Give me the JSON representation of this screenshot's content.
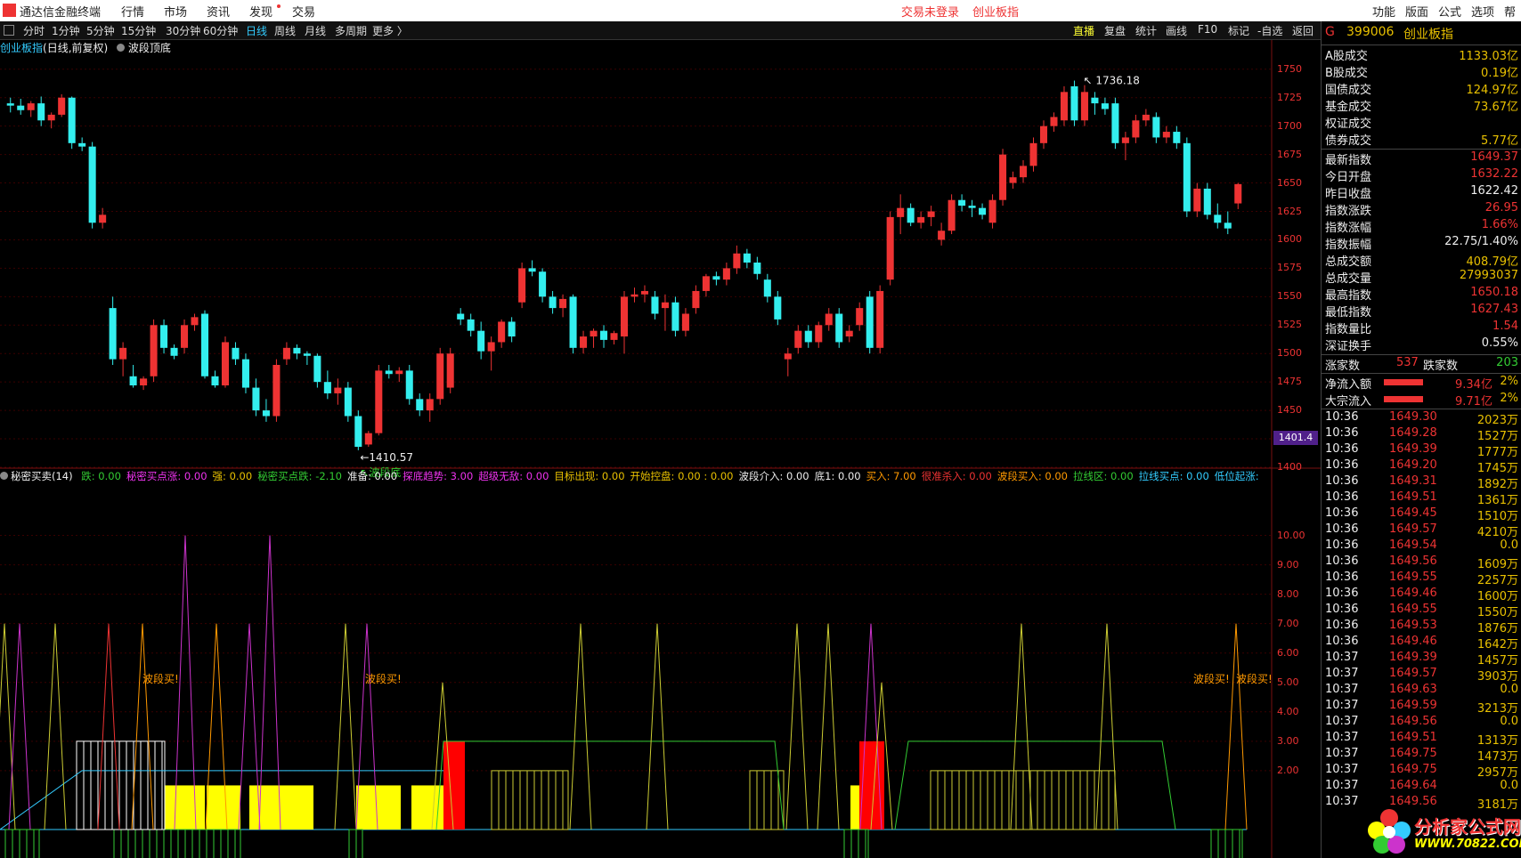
{
  "window": {
    "menu": [
      "通达信金融终端",
      "行情",
      "市场",
      "资讯",
      "发现",
      "交易"
    ],
    "status_left": "交易未登录",
    "status_right": "创业板指",
    "menu_right": [
      "功能",
      "版面",
      "公式",
      "选项",
      "帮"
    ]
  },
  "toolbar": {
    "periods": [
      "分时",
      "1分钟",
      "5分钟",
      "15分钟",
      "30分钟",
      "60分钟",
      "日线",
      "周线",
      "月线",
      "多周期",
      "更多 〉"
    ],
    "active_period": "日线",
    "right": [
      "直播",
      "复盘",
      "统计",
      "画线",
      "F10",
      "标记",
      "-自选",
      "返回"
    ]
  },
  "chart": {
    "name": "创业板指",
    "sub": "(日线,前复权)",
    "overlay": "波段顶底",
    "high_label": "1736.18",
    "low_label": "1410.57",
    "low_note": "↖波段底",
    "current_price_tag": "1401.4",
    "price_axis": [
      "1750",
      "1725",
      "1700",
      "1675",
      "1650",
      "1625",
      "1600",
      "1575",
      "1550",
      "1525",
      "1500",
      "1475",
      "1450",
      "1425",
      "1400"
    ],
    "ind_axis": [
      "10.00",
      "9.00",
      "8.00",
      "7.00",
      "6.00",
      "5.00",
      "4.00",
      "3.00",
      "2.00"
    ]
  },
  "indicator": {
    "name": "秘密买卖(14)",
    "items": [
      {
        "k": "跌",
        "v": "0.00",
        "c": "g"
      },
      {
        "k": "秘密买点涨",
        "v": "0.00",
        "c": "m"
      },
      {
        "k": "强",
        "v": "0.00",
        "c": "y"
      },
      {
        "k": "秘密买点跌",
        "v": "-2.10",
        "c": "g"
      },
      {
        "k": "准备",
        "v": "0.00",
        "c": "w"
      },
      {
        "k": "探底趋势",
        "v": "3.00",
        "c": "m"
      },
      {
        "k": "超级无敌",
        "v": "0.00",
        "c": "m"
      },
      {
        "k": "目标出现",
        "v": "0.00",
        "c": "y"
      },
      {
        "k": "开始控盘",
        "v": "0.00 : 0.00",
        "c": "y"
      },
      {
        "k": "波段介入",
        "v": "0.00",
        "c": "w"
      },
      {
        "k": "底1",
        "v": "0.00",
        "c": "w"
      },
      {
        "k": "买入",
        "v": "7.00",
        "c": "o"
      },
      {
        "k": "很准杀入",
        "v": "0.00",
        "c": "r"
      },
      {
        "k": "波段买入",
        "v": "0.00",
        "c": "o"
      },
      {
        "k": "拉线区",
        "v": "0.00",
        "c": "g"
      },
      {
        "k": "拉线买点",
        "v": "0.00",
        "c": "c"
      },
      {
        "k": "低位起涨",
        "v": "",
        "c": "c"
      }
    ],
    "buy_labels": [
      "波段买!",
      "波段买!",
      "波段买!",
      "波段买!"
    ]
  },
  "quote": {
    "code": "399006",
    "name": "创业板指",
    "badge": "G",
    "block1": [
      {
        "k": "A股成交",
        "v": "1133.03亿",
        "c": "y"
      },
      {
        "k": "B股成交",
        "v": "0.19亿",
        "c": "y"
      },
      {
        "k": "国债成交",
        "v": "124.97亿",
        "c": "y"
      },
      {
        "k": "基金成交",
        "v": "73.67亿",
        "c": "y"
      },
      {
        "k": "权证成交",
        "v": "",
        "c": "y"
      },
      {
        "k": "债券成交",
        "v": "5.77亿",
        "c": "y"
      }
    ],
    "block2": [
      {
        "k": "最新指数",
        "v": "1649.37",
        "c": "r"
      },
      {
        "k": "今日开盘",
        "v": "1632.22",
        "c": "r"
      },
      {
        "k": "昨日收盘",
        "v": "1622.42",
        "c": "w"
      },
      {
        "k": "指数涨跌",
        "v": "26.95",
        "c": "r"
      },
      {
        "k": "指数涨幅",
        "v": "1.66%",
        "c": "r"
      },
      {
        "k": "指数振幅",
        "v": "22.75/1.40%",
        "c": "w"
      },
      {
        "k": "总成交额",
        "v": "408.79亿",
        "c": "y"
      },
      {
        "k": "总成交量",
        "v": "27993037",
        "c": "y"
      },
      {
        "k": "最高指数",
        "v": "1650.18",
        "c": "r"
      },
      {
        "k": "最低指数",
        "v": "1627.43",
        "c": "r"
      },
      {
        "k": "指数量比",
        "v": "1.54",
        "c": "r"
      },
      {
        "k": "深证换手",
        "v": "0.55%",
        "c": "w"
      }
    ],
    "up_label": "涨家数",
    "up": "537",
    "down_label": "跌家数",
    "down": "203",
    "flow1_label": "净流入额",
    "flow1": "9.34亿",
    "flow1_pct": "2%",
    "flow2_label": "大宗流入",
    "flow2": "9.71亿",
    "flow2_pct": "2%",
    "ticks": [
      [
        "10:36",
        "1649.30",
        "2023万"
      ],
      [
        "10:36",
        "1649.28",
        "1527万"
      ],
      [
        "10:36",
        "1649.39",
        "1777万"
      ],
      [
        "10:36",
        "1649.20",
        "1745万"
      ],
      [
        "10:36",
        "1649.31",
        "1892万"
      ],
      [
        "10:36",
        "1649.51",
        "1361万"
      ],
      [
        "10:36",
        "1649.45",
        "1510万"
      ],
      [
        "10:36",
        "1649.57",
        "4210万"
      ],
      [
        "10:36",
        "1649.54",
        "0.0"
      ],
      [
        "10:36",
        "1649.56",
        "1609万"
      ],
      [
        "10:36",
        "1649.55",
        "2257万"
      ],
      [
        "10:36",
        "1649.46",
        "1600万"
      ],
      [
        "10:36",
        "1649.55",
        "1550万"
      ],
      [
        "10:36",
        "1649.53",
        "1876万"
      ],
      [
        "10:36",
        "1649.46",
        "1642万"
      ],
      [
        "10:37",
        "1649.39",
        "1457万"
      ],
      [
        "10:37",
        "1649.57",
        "3903万"
      ],
      [
        "10:37",
        "1649.63",
        "0.0"
      ],
      [
        "10:37",
        "1649.59",
        "3213万"
      ],
      [
        "10:37",
        "1649.56",
        "0.0"
      ],
      [
        "10:37",
        "1649.51",
        "1313万"
      ],
      [
        "10:37",
        "1649.75",
        "1473万"
      ],
      [
        "10:37",
        "1649.75",
        "2957万"
      ],
      [
        "10:37",
        "1649.64",
        "0.0"
      ],
      [
        "10:37",
        "1649.56",
        "3181万"
      ]
    ]
  },
  "watermark": {
    "line1": "分析家公式网",
    "line2": "WWW.70822.COM"
  },
  "colors": {
    "up": "#e33",
    "down": "#3ee",
    "yellow": "#ff0",
    "green": "#3c3",
    "magenta": "#c3c",
    "grid": "#4a0000"
  },
  "chart_data": {
    "type": "candlestick",
    "title": "创业板指",
    "ylim": [
      1400,
      1760
    ],
    "ohlc": [
      [
        1720,
        1725,
        1712,
        1718
      ],
      [
        1718,
        1724,
        1710,
        1714
      ],
      [
        1714,
        1722,
        1708,
        1720
      ],
      [
        1720,
        1726,
        1700,
        1705
      ],
      [
        1705,
        1712,
        1698,
        1710
      ],
      [
        1710,
        1728,
        1708,
        1725
      ],
      [
        1725,
        1726,
        1680,
        1685
      ],
      [
        1685,
        1690,
        1678,
        1682
      ],
      [
        1682,
        1686,
        1610,
        1615
      ],
      [
        1615,
        1628,
        1610,
        1622
      ],
      [
        1540,
        1550,
        1490,
        1495
      ],
      [
        1495,
        1510,
        1480,
        1505
      ],
      [
        1480,
        1490,
        1470,
        1472
      ],
      [
        1472,
        1480,
        1468,
        1478
      ],
      [
        1480,
        1530,
        1475,
        1525
      ],
      [
        1525,
        1530,
        1500,
        1505
      ],
      [
        1505,
        1508,
        1495,
        1498
      ],
      [
        1505,
        1530,
        1500,
        1525
      ],
      [
        1525,
        1535,
        1520,
        1532
      ],
      [
        1535,
        1538,
        1478,
        1480
      ],
      [
        1480,
        1485,
        1470,
        1472
      ],
      [
        1472,
        1515,
        1470,
        1510
      ],
      [
        1505,
        1510,
        1490,
        1495
      ],
      [
        1495,
        1500,
        1465,
        1470
      ],
      [
        1470,
        1478,
        1445,
        1450
      ],
      [
        1450,
        1460,
        1440,
        1445
      ],
      [
        1445,
        1495,
        1440,
        1490
      ],
      [
        1495,
        1510,
        1490,
        1505
      ],
      [
        1505,
        1508,
        1495,
        1500
      ],
      [
        1500,
        1502,
        1490,
        1498
      ],
      [
        1498,
        1500,
        1470,
        1475
      ],
      [
        1475,
        1485,
        1460,
        1465
      ],
      [
        1465,
        1478,
        1455,
        1470
      ],
      [
        1470,
        1475,
        1440,
        1445
      ],
      [
        1445,
        1450,
        1415,
        1418
      ],
      [
        1420,
        1432,
        1418,
        1430
      ],
      [
        1430,
        1490,
        1428,
        1485
      ],
      [
        1485,
        1490,
        1478,
        1482
      ],
      [
        1482,
        1488,
        1475,
        1485
      ],
      [
        1485,
        1490,
        1455,
        1460
      ],
      [
        1460,
        1465,
        1445,
        1450
      ],
      [
        1450,
        1465,
        1440,
        1460
      ],
      [
        1460,
        1505,
        1455,
        1500
      ],
      [
        1470,
        1505,
        1465,
        1500
      ],
      [
        1535,
        1540,
        1525,
        1530
      ],
      [
        1530,
        1535,
        1515,
        1520
      ],
      [
        1520,
        1528,
        1495,
        1502
      ],
      [
        1502,
        1515,
        1485,
        1510
      ],
      [
        1510,
        1530,
        1505,
        1528
      ],
      [
        1528,
        1532,
        1510,
        1515
      ],
      [
        1545,
        1580,
        1540,
        1575
      ],
      [
        1575,
        1582,
        1568,
        1572
      ],
      [
        1572,
        1575,
        1545,
        1550
      ],
      [
        1550,
        1555,
        1535,
        1540
      ],
      [
        1540,
        1552,
        1532,
        1548
      ],
      [
        1550,
        1552,
        1500,
        1505
      ],
      [
        1505,
        1520,
        1500,
        1515
      ],
      [
        1515,
        1522,
        1505,
        1520
      ],
      [
        1520,
        1525,
        1505,
        1512
      ],
      [
        1512,
        1520,
        1508,
        1518
      ],
      [
        1515,
        1555,
        1500,
        1550
      ],
      [
        1550,
        1558,
        1545,
        1552
      ],
      [
        1552,
        1560,
        1545,
        1555
      ],
      [
        1550,
        1555,
        1530,
        1535
      ],
      [
        1540,
        1552,
        1520,
        1545
      ],
      [
        1545,
        1550,
        1515,
        1520
      ],
      [
        1520,
        1540,
        1515,
        1535
      ],
      [
        1540,
        1560,
        1535,
        1555
      ],
      [
        1555,
        1570,
        1550,
        1568
      ],
      [
        1568,
        1572,
        1560,
        1565
      ],
      [
        1565,
        1580,
        1560,
        1575
      ],
      [
        1575,
        1595,
        1570,
        1588
      ],
      [
        1588,
        1592,
        1575,
        1580
      ],
      [
        1580,
        1585,
        1565,
        1570
      ],
      [
        1565,
        1570,
        1545,
        1550
      ],
      [
        1550,
        1555,
        1525,
        1530
      ],
      [
        1495,
        1505,
        1480,
        1500
      ],
      [
        1505,
        1525,
        1500,
        1520
      ],
      [
        1520,
        1525,
        1505,
        1510
      ],
      [
        1510,
        1528,
        1505,
        1525
      ],
      [
        1525,
        1540,
        1520,
        1535
      ],
      [
        1535,
        1540,
        1505,
        1510
      ],
      [
        1515,
        1525,
        1510,
        1520
      ],
      [
        1525,
        1545,
        1520,
        1540
      ],
      [
        1550,
        1555,
        1500,
        1505
      ],
      [
        1505,
        1560,
        1500,
        1555
      ],
      [
        1565,
        1625,
        1560,
        1620
      ],
      [
        1620,
        1640,
        1605,
        1628
      ],
      [
        1628,
        1632,
        1612,
        1615
      ],
      [
        1615,
        1625,
        1610,
        1620
      ],
      [
        1620,
        1630,
        1612,
        1625
      ],
      [
        1600,
        1615,
        1595,
        1608
      ],
      [
        1608,
        1640,
        1605,
        1635
      ],
      [
        1635,
        1640,
        1625,
        1630
      ],
      [
        1630,
        1635,
        1620,
        1628
      ],
      [
        1628,
        1632,
        1618,
        1622
      ],
      [
        1615,
        1640,
        1610,
        1635
      ],
      [
        1635,
        1680,
        1630,
        1675
      ],
      [
        1650,
        1660,
        1645,
        1655
      ],
      [
        1655,
        1670,
        1650,
        1665
      ],
      [
        1665,
        1690,
        1660,
        1685
      ],
      [
        1685,
        1705,
        1680,
        1700
      ],
      [
        1700,
        1712,
        1695,
        1708
      ],
      [
        1705,
        1735,
        1700,
        1730
      ],
      [
        1735,
        1740,
        1700,
        1705
      ],
      [
        1705,
        1736,
        1700,
        1730
      ],
      [
        1725,
        1730,
        1710,
        1720
      ],
      [
        1720,
        1725,
        1710,
        1715
      ],
      [
        1720,
        1725,
        1680,
        1685
      ],
      [
        1685,
        1695,
        1670,
        1690
      ],
      [
        1690,
        1710,
        1685,
        1705
      ],
      [
        1705,
        1715,
        1700,
        1710
      ],
      [
        1708,
        1712,
        1685,
        1690
      ],
      [
        1690,
        1700,
        1685,
        1695
      ],
      [
        1695,
        1700,
        1680,
        1685
      ],
      [
        1685,
        1690,
        1620,
        1625
      ],
      [
        1625,
        1650,
        1620,
        1645
      ],
      [
        1645,
        1650,
        1618,
        1622
      ],
      [
        1622,
        1632,
        1610,
        1615
      ],
      [
        1615,
        1625,
        1605,
        1610
      ],
      [
        1632,
        1650,
        1627,
        1649
      ]
    ]
  }
}
